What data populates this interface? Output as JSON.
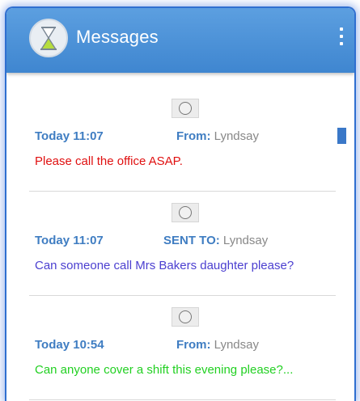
{
  "app": {
    "title": "Messages"
  },
  "colors": {
    "appbar": "#4a90d6",
    "accent": "#3f7dc2",
    "urgent": "#e01010",
    "info": "#4b3fd0",
    "request": "#22d022"
  },
  "messages": [
    {
      "time": "Today 11:07",
      "direction_label": "From:",
      "contact": "Lyndsay",
      "text": "Please call the office ASAP.",
      "text_color": "#e01010",
      "unread": true
    },
    {
      "time": "Today 11:07",
      "direction_label": "SENT TO:",
      "contact": "Lyndsay",
      "text": "Can someone call Mrs Bakers daughter please?",
      "text_color": "#4b3fd0",
      "unread": false
    },
    {
      "time": "Today 10:54",
      "direction_label": "From:",
      "contact": "Lyndsay",
      "text": "Can anyone cover a shift this evening please?...",
      "text_color": "#22d022",
      "unread": false
    }
  ]
}
